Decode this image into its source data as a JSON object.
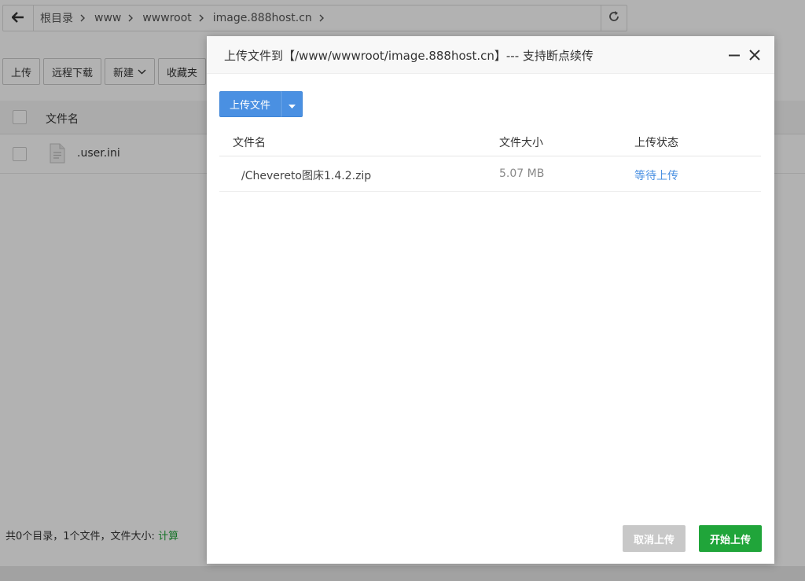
{
  "file_manager": {
    "breadcrumbs": [
      "根目录",
      "www",
      "wwwroot",
      "image.888host.cn"
    ],
    "toolbar": {
      "upload": "上传",
      "remote_download": "远程下载",
      "new": "新建",
      "favorites": "收藏夹"
    },
    "file_list": {
      "header_name": "文件名",
      "rows": [
        {
          "name": ".user.ini"
        }
      ]
    },
    "status": {
      "summary": "共0个目录，1个文件，文件大小: ",
      "calc_link": "计算"
    }
  },
  "upload_dialog": {
    "title": "上传文件到【/www/wwwroot/image.888host.cn】--- 支持断点续传",
    "upload_button": "上传文件",
    "columns": {
      "name": "文件名",
      "size": "文件大小",
      "status": "上传状态"
    },
    "files": [
      {
        "name": "/Chevereto图床1.4.2.zip",
        "size": "5.07 MB",
        "status": "等待上传"
      }
    ],
    "cancel_button": "取消上传",
    "start_button": "开始上传"
  },
  "colors": {
    "primary_blue": "#4a90e2",
    "success_green": "#20a53a",
    "disabled_gray": "#c8c8c8"
  },
  "icons": [
    "arrow-left-icon",
    "chevron-right-icon",
    "refresh-icon",
    "chevron-down-icon",
    "file-icon",
    "minimize-icon",
    "close-icon",
    "caret-down-icon"
  ]
}
